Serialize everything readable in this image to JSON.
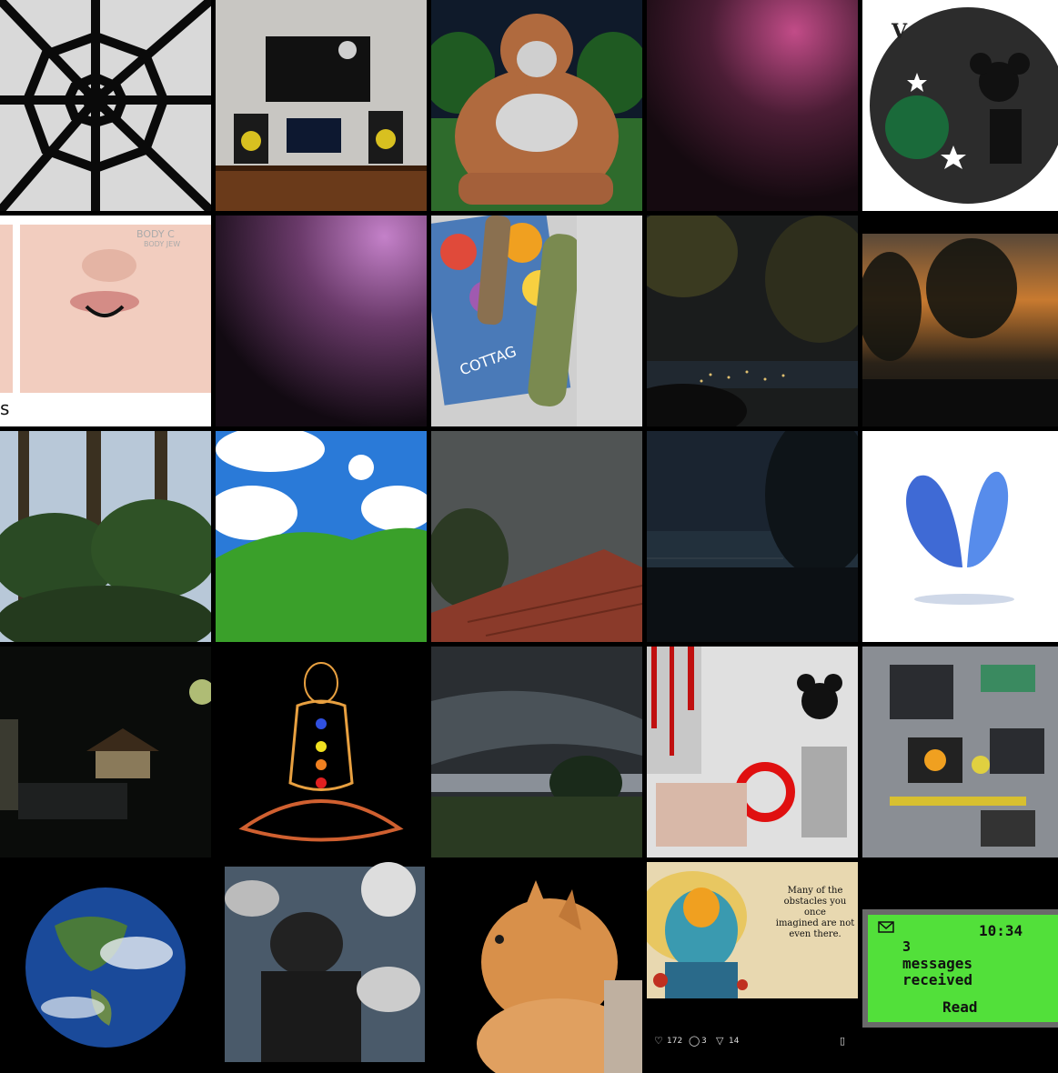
{
  "grid": {
    "tiles": [
      {
        "name": "black-web-pattern"
      },
      {
        "name": "desk-tv-setup"
      },
      {
        "name": "meditating-bigfoot"
      },
      {
        "name": "pink-gradient-1"
      },
      {
        "name": "mickey-collage-circle",
        "badge_text": "V"
      },
      {
        "name": "lip-piercing-ad",
        "brand": "BODY C",
        "brand_sub": "BODY JEW",
        "caption": "s"
      },
      {
        "name": "pink-gradient-2"
      },
      {
        "name": "flower-stones-keyboard",
        "seed_text": "COTTAG"
      },
      {
        "name": "night-city-trees"
      },
      {
        "name": "sunset-trees"
      },
      {
        "name": "pine-forest"
      },
      {
        "name": "green-hill-sky"
      },
      {
        "name": "storm-roof"
      },
      {
        "name": "dark-lake-night"
      },
      {
        "name": "blue-butterfly"
      },
      {
        "name": "night-house-street"
      },
      {
        "name": "chakra-meditation"
      },
      {
        "name": "storm-field"
      },
      {
        "name": "mickey-biohazard-collage"
      },
      {
        "name": "lego-circuit-board"
      },
      {
        "name": "earth-globe"
      },
      {
        "name": "mono-halftone-figure"
      },
      {
        "name": "orange-cat"
      },
      {
        "name": "ganesha-quote",
        "quote": [
          "Many of the",
          "obstacles you once",
          "imagined are not",
          "even there."
        ],
        "likes": "172",
        "comments": "3",
        "shares": "14"
      },
      {
        "name": "nokia-phone-screen",
        "time": "10:34",
        "count": "3",
        "line1": "messages",
        "line2": "received",
        "action": "Read"
      }
    ]
  },
  "colors": {
    "background": "#000000",
    "phone_screen": "#52e03a",
    "pink": "#c04a8a"
  }
}
